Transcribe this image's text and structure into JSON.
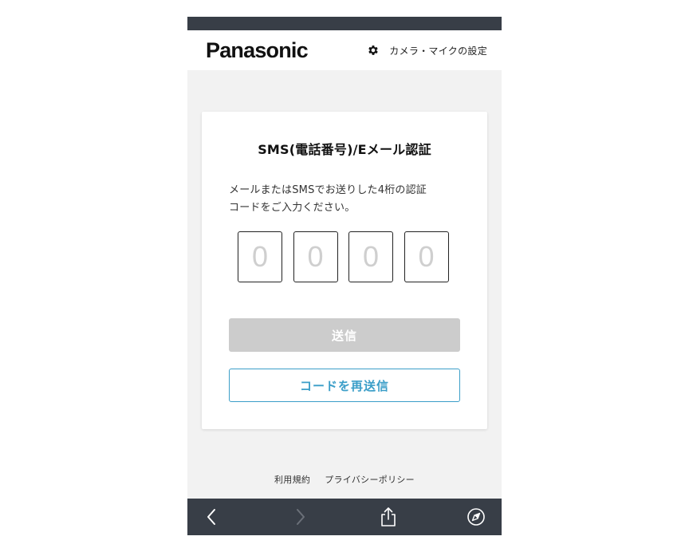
{
  "header": {
    "logo": "Panasonic",
    "settings_label": "カメラ・マイクの設定"
  },
  "card": {
    "title": "SMS(電話番号)/Eメール認証",
    "instruction_line1": "メールまたはSMSでお送りした4桁の認証",
    "instruction_line2": "コードをご入力ください。",
    "code_placeholders": [
      "0",
      "0",
      "0",
      "0"
    ],
    "submit_label": "送信",
    "resend_label": "コードを再送信"
  },
  "footer": {
    "terms_label": "利用規約",
    "privacy_label": "プライバシーポリシー"
  },
  "toolbar": {
    "icons": [
      "back-arrow-icon",
      "forward-arrow-icon",
      "share-icon",
      "compass-icon"
    ]
  },
  "colors": {
    "status_bar": "#383e47",
    "accent": "#3b9ec8",
    "disabled_button": "#cccccc",
    "page_background": "#f2f2f2"
  }
}
